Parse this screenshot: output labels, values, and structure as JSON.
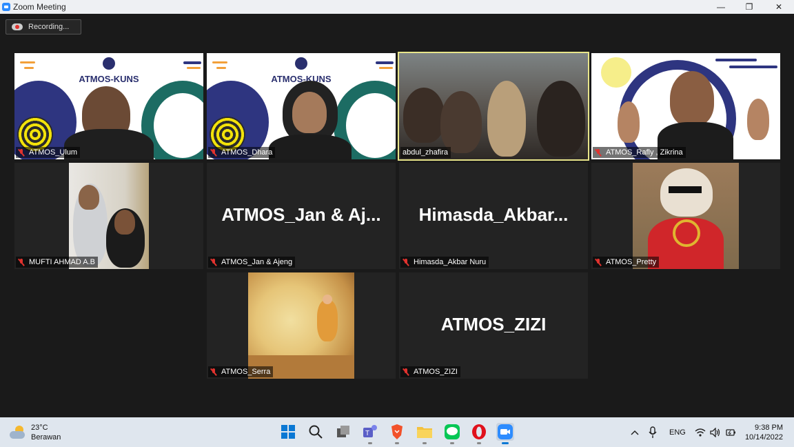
{
  "window": {
    "title": "Zoom Meeting",
    "minimize": "—",
    "restore": "❐",
    "close": "✕"
  },
  "recording": {
    "label": "Recording..."
  },
  "tiles": [
    {
      "name": "ATMOS_Ulum",
      "banner": "ATMOS-KUNS"
    },
    {
      "name": "ATMOS_Dhara",
      "banner": "ATMOS-KUNS"
    },
    {
      "name": "abdul_zhafira"
    },
    {
      "name": "ATMOS_Rafly , Zikrina"
    },
    {
      "name": "MUFTI AHMAD A.B"
    },
    {
      "name": "ATMOS_Jan & Ajeng",
      "display": "ATMOS_Jan & Aj..."
    },
    {
      "name": "Himasda_Akbar Nuru",
      "display": "Himasda_Akbar..."
    },
    {
      "name": "ATMOS_Pretty"
    },
    {
      "name": "ATMOS_Serra"
    },
    {
      "name": "ATMOS_ZIZI",
      "display": "ATMOS_ZIZI"
    }
  ],
  "taskbar": {
    "weather": {
      "temp": "23°C",
      "condition": "Berawan"
    },
    "language": "ENG",
    "time": "9:38 PM",
    "date": "10/14/2022"
  },
  "colors": {
    "active_speaker": "#e8e58a",
    "zoom_blue": "#2d8cff",
    "mute_red": "#e0322e"
  }
}
